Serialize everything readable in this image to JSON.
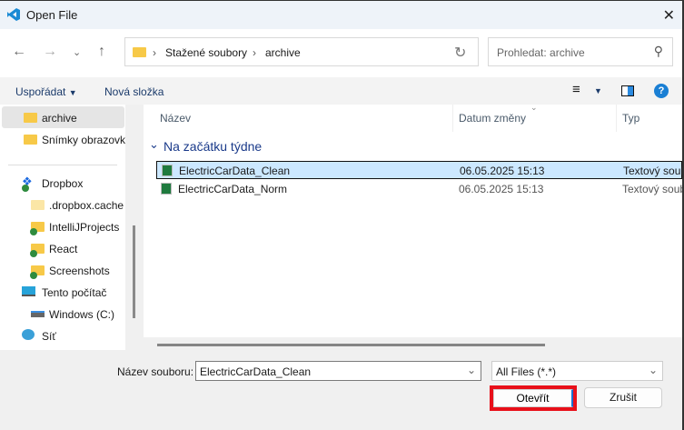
{
  "window": {
    "title": "Open File"
  },
  "nav": {
    "breadcrumb": [
      "Stažené soubory",
      "archive"
    ],
    "search_placeholder": "Prohledat: archive"
  },
  "toolbar": {
    "organize": "Uspořádat",
    "new_folder": "Nová složka"
  },
  "sidebar": {
    "items": [
      {
        "label": "archive",
        "icon": "folder-icon",
        "selected": true
      },
      {
        "label": "Snímky obrazovky",
        "icon": "folder-icon"
      },
      {
        "label": "Dropbox",
        "icon": "dropbox-icon"
      },
      {
        "label": ".dropbox.cache",
        "icon": "folder-icon"
      },
      {
        "label": "IntelliJProjects",
        "icon": "folder-synced-icon"
      },
      {
        "label": "React",
        "icon": "folder-synced-icon"
      },
      {
        "label": "Screenshots",
        "icon": "folder-synced-icon"
      },
      {
        "label": "Tento počítač",
        "icon": "computer-icon"
      },
      {
        "label": "Windows  (C:)",
        "icon": "drive-icon"
      },
      {
        "label": "Síť",
        "icon": "network-icon"
      }
    ]
  },
  "list": {
    "columns": [
      "Název",
      "Datum změny",
      "Typ"
    ],
    "group": "Na začátku týdne",
    "rows": [
      {
        "name": "ElectricCarData_Clean",
        "date": "06.05.2025 15:13",
        "type": "Textový soubor",
        "selected": true
      },
      {
        "name": "ElectricCarData_Norm",
        "date": "06.05.2025 15:13",
        "type": "Textový soubor"
      }
    ]
  },
  "footer": {
    "filename_label": "Název souboru:",
    "filename_value": "ElectricCarData_Clean",
    "filter": "All Files (*.*)",
    "open": "Otevřít",
    "cancel": "Zrušit"
  },
  "colors": {
    "accent": "#0067c0",
    "highlight": "#e8101a",
    "selection": "#cce8ff"
  }
}
